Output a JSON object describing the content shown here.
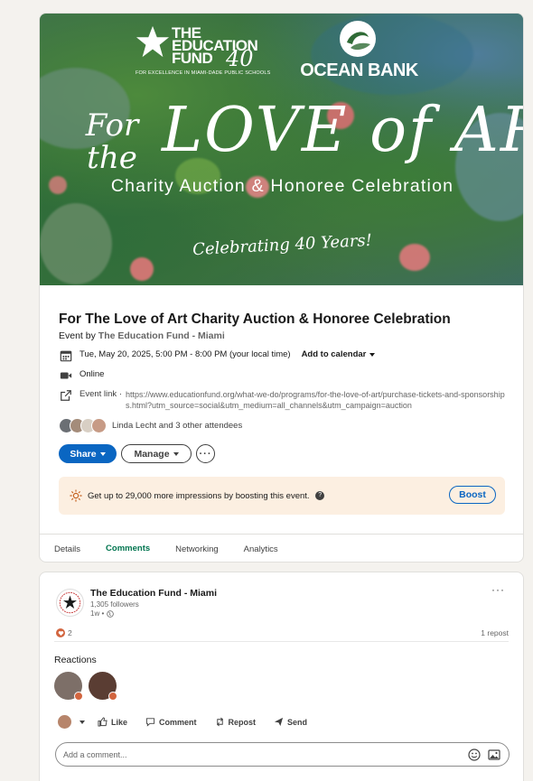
{
  "banner": {
    "ef_line1": "THE",
    "ef_line2": "EDUCATION",
    "ef_line3": "FUND",
    "ef_40": "40",
    "ef_tagline": "FOR EXCELLENCE IN MIAMI-DADE PUBLIC SCHOOLS",
    "ob_name": "OCEAN BANK",
    "script_for": "For",
    "script_the": "the",
    "script_love_art": "LOVE of ART",
    "subtitle": "Charity Auction & Honoree Celebration",
    "celebrating": "Celebrating 40 Years!"
  },
  "event": {
    "title": "For The Love of Art Charity Auction & Honoree Celebration",
    "by_prefix": "Event by",
    "organizer": "The Education Fund - Miami",
    "datetime": "Tue, May 20, 2025, 5:00 PM - 8:00 PM (your local time)",
    "add_calendar": "Add to calendar",
    "format": "Online",
    "link_label": "Event link ·",
    "link_url": "https://www.educationfund.org/what-we-do/programs/for-the-love-of-art/purchase-tickets-and-sponsorships.html?utm_source=social&utm_medium=all_channels&utm_campaign=auction",
    "attendees_text": "Linda Lecht and 3 other attendees"
  },
  "actions": {
    "share": "Share",
    "manage": "Manage",
    "more": "···"
  },
  "boost": {
    "text": "Get up to 29,000 more impressions by boosting this event.",
    "button": "Boost"
  },
  "tabs": [
    {
      "label": "Details"
    },
    {
      "label": "Comments"
    },
    {
      "label": "Networking"
    },
    {
      "label": "Analytics"
    }
  ],
  "active_tab": "Comments",
  "post": {
    "author": "The Education Fund - Miami",
    "followers": "1,305 followers",
    "time": "1w •",
    "more": "···",
    "reaction_count": "2",
    "reposts": "1 repost",
    "reactions_label": "Reactions",
    "like": "Like",
    "comment": "Comment",
    "repost": "Repost",
    "send": "Send",
    "comment_placeholder": "Add a comment..."
  },
  "colors": {
    "brand_blue": "#0a66c2",
    "active_green": "#01754f",
    "boost_bg": "#fcefe1",
    "heart": "#d2653f"
  }
}
